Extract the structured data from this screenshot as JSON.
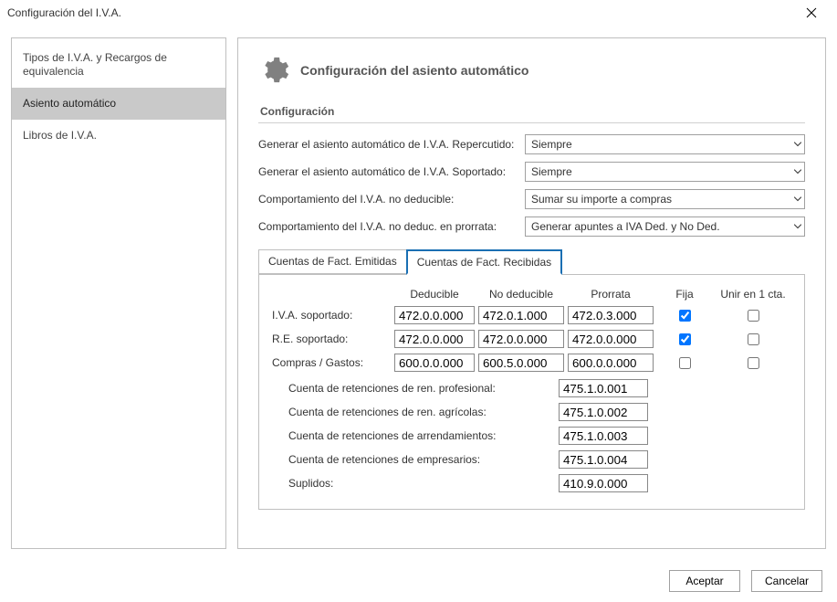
{
  "window": {
    "title": "Configuración del I.V.A."
  },
  "sidebar": {
    "items": [
      {
        "label": "Tipos de I.V.A. y Recargos de equivalencia"
      },
      {
        "label": "Asiento automático"
      },
      {
        "label": "Libros de I.V.A."
      }
    ]
  },
  "header": {
    "title": "Configuración del asiento automático"
  },
  "section": {
    "title": "Configuración"
  },
  "form": {
    "rows": [
      {
        "label": "Generar el asiento automático de I.V.A. Repercutido:",
        "value": "Siempre"
      },
      {
        "label": "Generar el asiento automático de I.V.A. Soportado:",
        "value": "Siempre"
      },
      {
        "label": "Comportamiento del I.V.A. no deducible:",
        "value": "Sumar su importe a compras"
      },
      {
        "label": "Comportamiento del I.V.A. no deduc. en prorrata:",
        "value": "Generar apuntes a IVA Ded. y No Ded."
      }
    ]
  },
  "tabs": {
    "emitidas": "Cuentas de Fact. Emitidas",
    "recibidas": "Cuentas de Fact. Recibidas"
  },
  "gridHeaders": {
    "deducible": "Deducible",
    "noDeducible": "No deducible",
    "prorrata": "Prorrata",
    "fija": "Fija",
    "unir": "Unir en 1 cta."
  },
  "gridRows": [
    {
      "label": "I.V.A. soportado:",
      "deducible": "472.0.0.000",
      "noDeducible": "472.0.1.000",
      "prorrata": "472.0.3.000",
      "fija": true,
      "unir": false
    },
    {
      "label": "R.E. soportado:",
      "deducible": "472.0.0.000",
      "noDeducible": "472.0.0.000",
      "prorrata": "472.0.0.000",
      "fija": true,
      "unir": false
    },
    {
      "label": "Compras / Gastos:",
      "deducible": "600.0.0.000",
      "noDeducible": "600.5.0.000",
      "prorrata": "600.0.0.000",
      "fija": false,
      "unir": false
    }
  ],
  "retRows": [
    {
      "label": "Cuenta de retenciones de ren. profesional:",
      "value": "475.1.0.001"
    },
    {
      "label": "Cuenta de retenciones de ren. agrícolas:",
      "value": "475.1.0.002"
    },
    {
      "label": "Cuenta de retenciones de arrendamientos:",
      "value": "475.1.0.003"
    },
    {
      "label": "Cuenta de retenciones de empresarios:",
      "value": "475.1.0.004"
    },
    {
      "label": "Suplidos:",
      "value": "410.9.0.000"
    }
  ],
  "footer": {
    "accept": "Aceptar",
    "cancel": "Cancelar"
  }
}
